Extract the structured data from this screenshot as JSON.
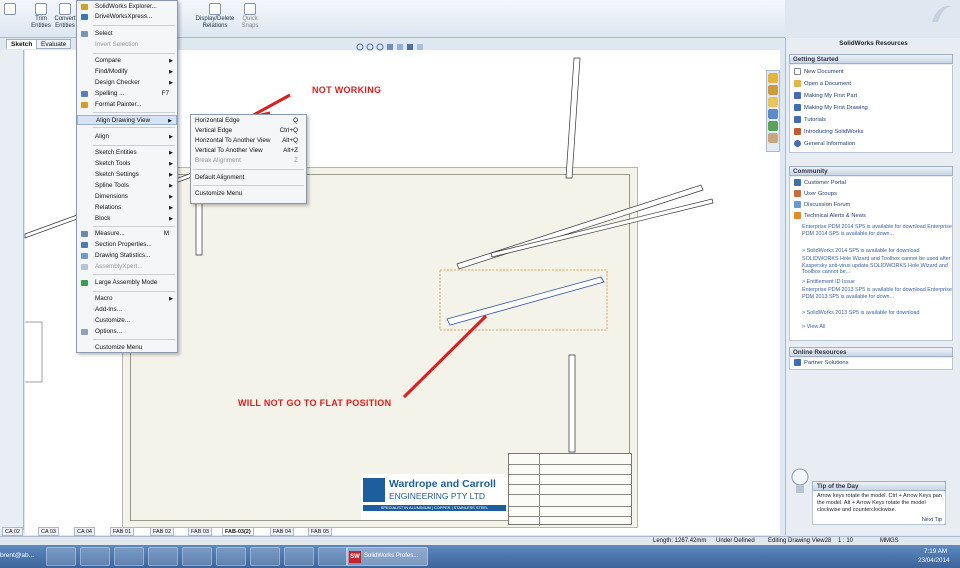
{
  "ribbon": {
    "trim_entities": "Trim Entities",
    "convert_entities": "Convert Entities",
    "display_delete_relations": "Display/Delete Relations",
    "quick_snaps": "Quick Snaps"
  },
  "command_tabs": [
    "Sketch",
    "Evaluate"
  ],
  "menu": {
    "items": [
      {
        "label": "SolidWorks Explorer..."
      },
      {
        "label": "DriveWorksXpress..."
      },
      {
        "label": "Select"
      },
      {
        "label": "Invert Selection"
      },
      {
        "label": "Compare"
      },
      {
        "label": "Find/Modify"
      },
      {
        "label": "Design Checker"
      },
      {
        "label": "Spelling ...",
        "shortcut": "F7"
      },
      {
        "label": "Format Painter..."
      },
      {
        "label": "Align Drawing View"
      },
      {
        "label": "Align"
      },
      {
        "label": "Sketch Entities"
      },
      {
        "label": "Sketch Tools"
      },
      {
        "label": "Sketch Settings"
      },
      {
        "label": "Spline Tools"
      },
      {
        "label": "Dimensions"
      },
      {
        "label": "Relations"
      },
      {
        "label": "Block"
      },
      {
        "label": "Measure...",
        "shortcut": "M"
      },
      {
        "label": "Section Properties..."
      },
      {
        "label": "Drawing Statistics..."
      },
      {
        "label": "AssemblyXpert..."
      },
      {
        "label": "Large Assembly Mode"
      },
      {
        "label": "Macro"
      },
      {
        "label": "Add-Ins..."
      },
      {
        "label": "Customize..."
      },
      {
        "label": "Options..."
      },
      {
        "label": "Customize Menu"
      }
    ]
  },
  "submenu": {
    "items": [
      {
        "label": "Horizontal Edge",
        "shortcut": "Q"
      },
      {
        "label": "Vertical Edge",
        "shortcut": "Ctrl+Q"
      },
      {
        "label": "Horizontal To Another View",
        "shortcut": "Alt+Q"
      },
      {
        "label": "Vertical To Another View",
        "shortcut": "Alt+Z"
      },
      {
        "label": "Break Alignment",
        "shortcut": "Z"
      },
      {
        "label": "Default Alignment"
      },
      {
        "label": "Customize Menu"
      }
    ]
  },
  "annotations": {
    "not_working": "NOT WORKING",
    "flat": "WILL NOT GO TO FLAT POSITION"
  },
  "logo": {
    "line1": "Wardrope and Carroll",
    "line2": "ENGINEERING PTY LTD",
    "tagline": "SPECIALIST IN ALUMINIUM | COPPER | STAINLESS STEEL"
  },
  "panel": {
    "title": "SolidWorks Resources",
    "getting_started": {
      "heading": "Getting Started",
      "items": [
        "New Document",
        "Open a Document",
        "Making My First Part",
        "Making My First Drawing",
        "Tutorials",
        "Introducing SolidWorks",
        "General Information"
      ]
    },
    "community": {
      "heading": "Community",
      "items": [
        "Customer Portal",
        "User Groups",
        "Discussion Forum",
        "Technical Alerts & News"
      ],
      "news": [
        "Enterprise PDM 2014 SP5 is available for download Enterprise PDM 2014 SP5 is available for down...",
        "> SolidWorks 2014 SP5 is available for download",
        "SOLIDWORKS Hole Wizard and Toolbox cannot be used after Kaspersky anti-virus update SOLIDWORKS Hole Wizard and Toolbox cannot be...",
        "> Entitlement ID Issue",
        "Enterprise PDM 2013 SP5 is available for download Enterprise PDM 2013 SP5 is available for down...",
        "> SolidWorks 2013 SP5 is available for download",
        "> View All"
      ]
    },
    "online_resources": {
      "heading": "Online Resources",
      "items": [
        "Partner Solutions"
      ]
    },
    "tip": {
      "heading": "Tip of the Day",
      "text": "Arrow keys rotate the model. Ctrl + Arrow Keys pan the model. Alt + Arrow Keys rotate the model clockwise and counterclockwise.",
      "next": "Next Tip"
    }
  },
  "sheet_tabs": [
    "CA 02",
    "CA 03",
    "CA 04",
    "FAB 01",
    "FAB 02",
    "FAB 03",
    "FAB-03(2)",
    "FAB 04",
    "FAB 05"
  ],
  "status": {
    "length": "Length: 1267.42mm",
    "defined": "Under Defined",
    "editing": "Editing Drawing View28",
    "scale": "1 : 10",
    "units": "MMGS"
  },
  "taskbar": {
    "user": "brent@ab...",
    "active_app": "SolidWorks Profes...",
    "time": "7:19 AM",
    "date": "23/04/2014"
  }
}
